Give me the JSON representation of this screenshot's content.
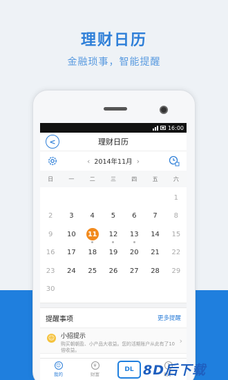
{
  "hero": {
    "title": "理财日历",
    "subtitle": "金融琐事，智能提醒"
  },
  "status": {
    "time": "16:00"
  },
  "nav": {
    "title": "理财日历"
  },
  "calendar": {
    "month_label": "2014年11月",
    "weekdays": [
      "日",
      "一",
      "二",
      "三",
      "四",
      "五",
      "六"
    ],
    "days": [
      {
        "n": "",
        "m": false
      },
      {
        "n": "",
        "m": false
      },
      {
        "n": "",
        "m": false
      },
      {
        "n": "",
        "m": false
      },
      {
        "n": "",
        "m": false
      },
      {
        "n": "",
        "m": false
      },
      {
        "n": "1",
        "m": true
      },
      {
        "n": "2",
        "m": true
      },
      {
        "n": "3",
        "m": false
      },
      {
        "n": "4",
        "m": false
      },
      {
        "n": "5",
        "m": false
      },
      {
        "n": "6",
        "m": false
      },
      {
        "n": "7",
        "m": false
      },
      {
        "n": "8",
        "m": true
      },
      {
        "n": "9",
        "m": true
      },
      {
        "n": "10",
        "m": false
      },
      {
        "n": "11",
        "m": false,
        "today": true,
        "dot": true
      },
      {
        "n": "12",
        "m": false,
        "dot": true
      },
      {
        "n": "13",
        "m": false,
        "dot": true
      },
      {
        "n": "14",
        "m": false
      },
      {
        "n": "15",
        "m": true
      },
      {
        "n": "16",
        "m": true
      },
      {
        "n": "17",
        "m": false
      },
      {
        "n": "18",
        "m": false
      },
      {
        "n": "19",
        "m": false
      },
      {
        "n": "20",
        "m": false
      },
      {
        "n": "21",
        "m": false
      },
      {
        "n": "22",
        "m": true
      },
      {
        "n": "23",
        "m": true
      },
      {
        "n": "24",
        "m": false
      },
      {
        "n": "25",
        "m": false
      },
      {
        "n": "26",
        "m": false
      },
      {
        "n": "27",
        "m": false
      },
      {
        "n": "28",
        "m": false
      },
      {
        "n": "29",
        "m": true
      },
      {
        "n": "30",
        "m": true
      }
    ]
  },
  "reminders": {
    "title": "提醒事项",
    "more": "更多提醒",
    "tip_title": "小招提示",
    "tip_text": "购买朝朝盈、小产品大收益。您的活期账户从此有了10倍收益。"
  },
  "tabs": [
    {
      "label": "我的",
      "icon": "user-icon",
      "glyph": "☺",
      "active": true
    },
    {
      "label": "财富",
      "icon": "yen-icon",
      "glyph": "¥",
      "active": false
    },
    {
      "label": "生活",
      "icon": "life-icon",
      "glyph": "◎",
      "active": false
    },
    {
      "label": "助手",
      "icon": "assistant-icon",
      "glyph": "?",
      "active": false
    }
  ],
  "watermark": {
    "logo": "DL",
    "text": "8D后下载"
  },
  "colors": {
    "accent": "#2e7fd8",
    "today": "#f28a1d",
    "banner": "#1f7fde"
  }
}
